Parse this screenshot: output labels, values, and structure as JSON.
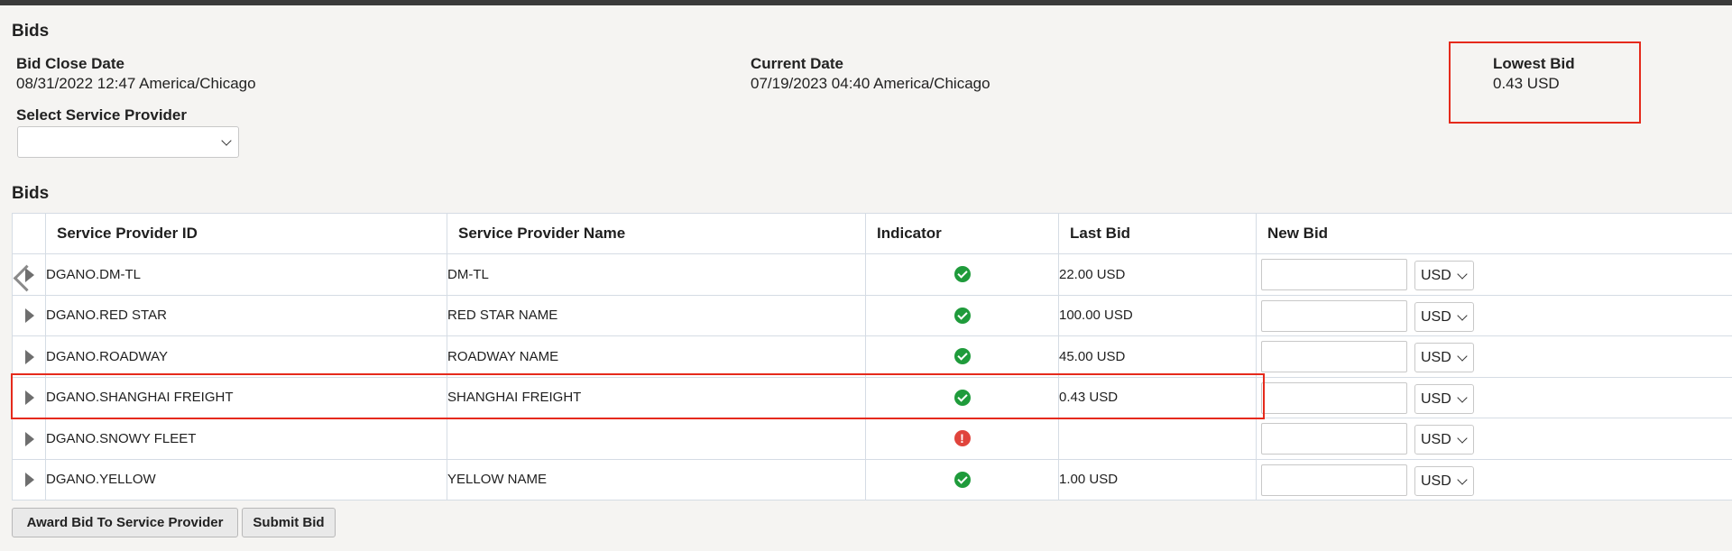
{
  "page": {
    "section_title": "Bids",
    "bid_close_date": {
      "label": "Bid Close Date",
      "value": "08/31/2022 12:47 America/Chicago"
    },
    "current_date": {
      "label": "Current Date",
      "value": "07/19/2023 04:40 America/Chicago"
    },
    "lowest_bid": {
      "label": "Lowest Bid",
      "value": "0.43 USD"
    },
    "service_provider_select": {
      "label": "Select Service Provider",
      "value": ""
    }
  },
  "table": {
    "title": "Bids",
    "columns": [
      "Service Provider ID",
      "Service Provider Name",
      "Indicator",
      "Last Bid",
      "New Bid"
    ],
    "rows": [
      {
        "id": "DGANO.DM-TL",
        "name": "DM-TL",
        "indicator": "ok",
        "last_bid": "22.00 USD",
        "currency": "USD"
      },
      {
        "id": "DGANO.RED STAR",
        "name": "RED STAR NAME",
        "indicator": "ok",
        "last_bid": "100.00 USD",
        "currency": "USD"
      },
      {
        "id": "DGANO.ROADWAY",
        "name": "ROADWAY NAME",
        "indicator": "ok",
        "last_bid": "45.00 USD",
        "currency": "USD"
      },
      {
        "id": "DGANO.SHANGHAI FREIGHT",
        "name": "SHANGHAI FREIGHT",
        "indicator": "ok",
        "last_bid": "0.43 USD",
        "currency": "USD"
      },
      {
        "id": "DGANO.SNOWY FLEET",
        "name": "",
        "indicator": "error",
        "last_bid": "",
        "currency": "USD"
      },
      {
        "id": "DGANO.YELLOW",
        "name": "YELLOW NAME",
        "indicator": "ok",
        "last_bid": "1.00 USD",
        "currency": "USD"
      }
    ]
  },
  "buttons": {
    "award": "Award Bid To Service Provider",
    "submit": "Submit Bid"
  },
  "colors": {
    "highlight": "#e52a1c",
    "ok": "#1f9b3b",
    "error": "#e0443c"
  },
  "icons": {
    "ok": "check-circle-icon",
    "error": "exclamation-circle-icon",
    "expand": "triangle-right-icon"
  }
}
